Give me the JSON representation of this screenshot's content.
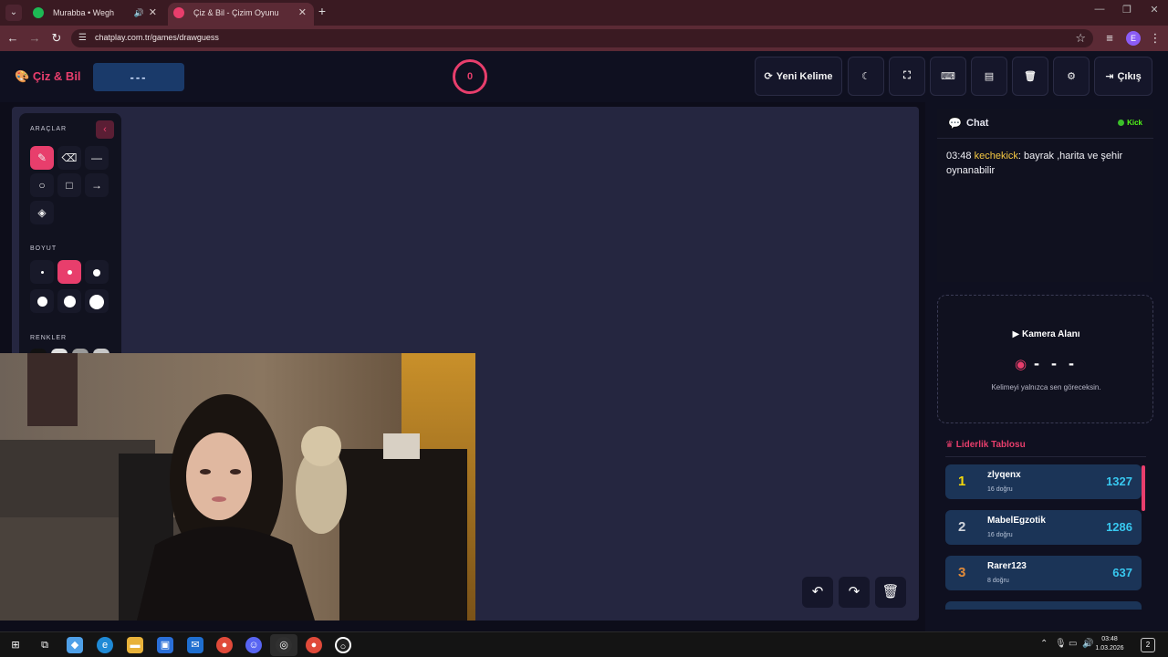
{
  "browser": {
    "tabs": [
      {
        "title": "Murabba • Wegh",
        "favicon_color": "#1db954"
      },
      {
        "title": "Çiz & Bil - Çizim Oyunu",
        "favicon_color": "#e83e6c"
      }
    ],
    "url": "chatplay.com.tr/games/drawguess",
    "profile_initial": "E"
  },
  "app": {
    "logo": "Çiz & Bil",
    "current_word": "---",
    "timer": "0",
    "buttons": {
      "new_word": "Yeni Kelime",
      "exit": "Çıkış"
    }
  },
  "tools": {
    "section_tools": "ARAÇLAR",
    "section_size": "BOYUT",
    "section_colors": "RENKLER",
    "selected_tool": "brush",
    "selected_size": 2,
    "color_swatches": [
      "#111111",
      "#e0e0e0",
      "#9a9a9a",
      "#c8c8c8"
    ]
  },
  "chat": {
    "title": "Chat",
    "platform": "Kick",
    "messages": [
      {
        "time": "03:48",
        "user": "kechekick",
        "text": ": bayrak ,harita ve şehir oynanabilir"
      }
    ]
  },
  "camera": {
    "title": "Kamera Alanı",
    "word": "- - -",
    "note": "Kelimeyi yalnızca sen göreceksin."
  },
  "leaderboard": {
    "title": "Liderlik Tablosu",
    "rows": [
      {
        "rank": "1",
        "name": "zlyqenx",
        "sub": "16 doğru",
        "score": "1327",
        "rank_color": "#f5d90a"
      },
      {
        "rank": "2",
        "name": "MabelEgzotik",
        "sub": "16 doğru",
        "score": "1286",
        "rank_color": "#d0d4dc"
      },
      {
        "rank": "3",
        "name": "Rarer123",
        "sub": "8 doğru",
        "score": "637",
        "rank_color": "#e08a3a"
      }
    ]
  },
  "taskbar": {
    "time": "03:48",
    "date": "1.03.2026",
    "notifications": "2"
  }
}
